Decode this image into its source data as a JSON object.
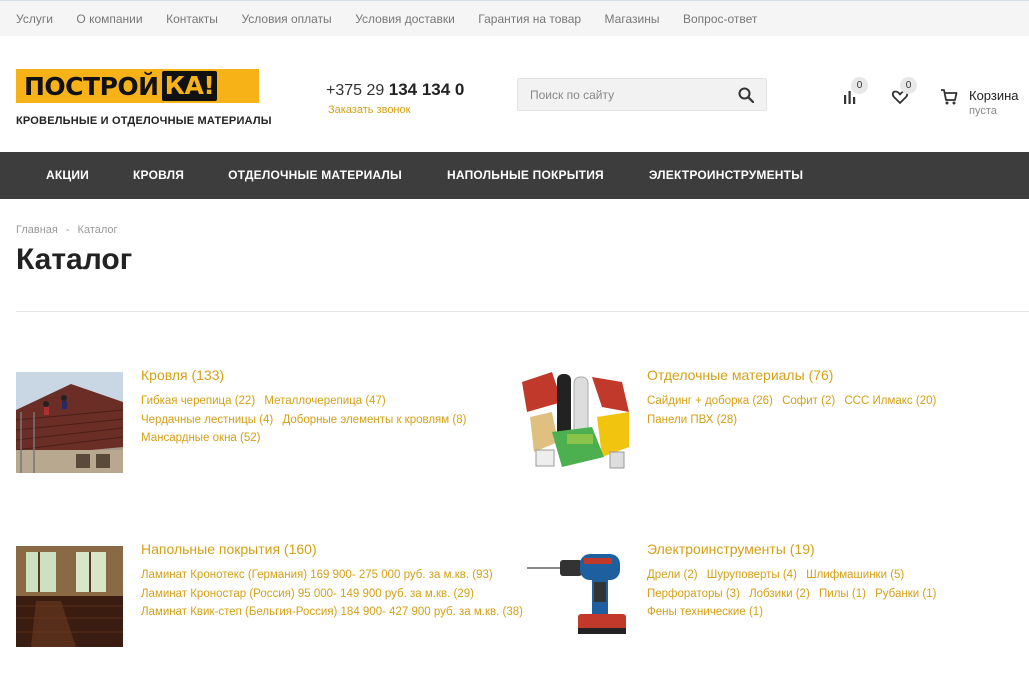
{
  "topnav": [
    "Услуги",
    "О компании",
    "Контакты",
    "Условия оплаты",
    "Условия доставки",
    "Гарантия на товар",
    "Магазины",
    "Вопрос-ответ"
  ],
  "logo": {
    "text_main": "ПОСТРОЙ",
    "text_ka": "КА!",
    "subtitle": "КРОВЕЛЬНЫЕ И ОТДЕЛОЧНЫЕ МАТЕРИАЛЫ"
  },
  "phone": {
    "prefix": "+375 29 ",
    "number": "134 134 0",
    "callback": "Заказать звонок"
  },
  "search": {
    "placeholder": "Поиск по сайту"
  },
  "compare": {
    "count": "0"
  },
  "favorites": {
    "count": "0"
  },
  "cart": {
    "title": "Корзина",
    "status": "пуста"
  },
  "mainnav": [
    "Акции",
    "Кровля",
    "Отделочные материалы",
    "Напольные покрытия",
    "Электроинструменты"
  ],
  "breadcrumbs": [
    "Главная",
    "Каталог"
  ],
  "page_title": "Каталог",
  "categories": [
    {
      "title": "Кровля (133)",
      "subs": [
        "Гибкая черепица (22)",
        "Металлочерепица (47)",
        "Чердачные лестницы (4)",
        "Доборные элементы к кровлям (8)",
        "Мансардные окна (52)"
      ]
    },
    {
      "title": "Отделочные материалы (76)",
      "subs": [
        "Сайдинг + доборка (26)",
        "Софит (2)",
        "CCC Илмакс (20)",
        "Панели ПВХ (28)"
      ]
    },
    {
      "title": "Напольные покрытия (160)",
      "subs": [
        "Ламинат Кронотекс (Германия) 169 900- 275 000 руб. за м.кв. (93)",
        "Ламинат Кроностар (Россия) 95 000- 149 900 руб. за м.кв. (29)",
        "Ламинат Квик-степ (Бельгия-Россия) 184 900- 427 900 руб. за м.кв. (38)"
      ]
    },
    {
      "title": "Электроинструменты (19)",
      "subs": [
        "Дрели (2)",
        "Шуруповерты (4)",
        "Шлифмашинки (5)",
        "Перфораторы (3)",
        "Лобзики (2)",
        "Пилы (1)",
        "Рубанки (1)",
        "Фены технические (1)"
      ]
    }
  ],
  "colors": {
    "accent": "#d4a017",
    "logo_yellow": "#f7b217",
    "nav_bg": "#3d3d3d"
  }
}
